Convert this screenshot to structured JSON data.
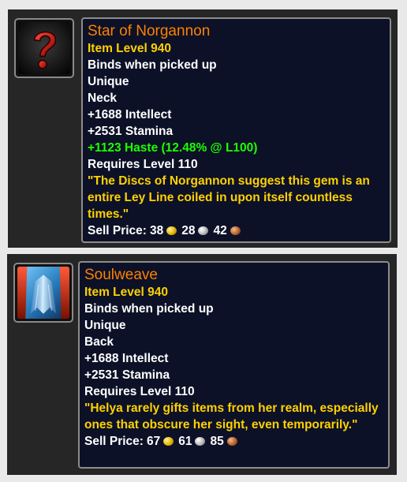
{
  "items": [
    {
      "icon": "question-mark-icon",
      "name": "Star of Norgannon",
      "item_level": "Item Level 940",
      "binding": "Binds when picked up",
      "unique": "Unique",
      "slot": "Neck",
      "stats": [
        "+1688 Intellect",
        "+2531 Stamina"
      ],
      "bonus": "+1123 Haste (12.48% @ L100)",
      "requires": "Requires Level 110",
      "flavor": "\"The Discs of Norgannon suggest this gem is an entire Ley Line coiled in upon itself countless times.\"",
      "sell_label": "Sell Price:",
      "sell": {
        "gold": "38",
        "silver": "28",
        "copper": "42"
      }
    },
    {
      "icon": "cloak-icon",
      "name": "Soulweave",
      "item_level": "Item Level 940",
      "binding": "Binds when picked up",
      "unique": "Unique",
      "slot": "Back",
      "stats": [
        "+1688 Intellect",
        "+2531 Stamina"
      ],
      "requires": "Requires Level 110",
      "flavor": "\"Helya rarely gifts items from her realm, especially ones that obscure her sight, even temporarily.\"",
      "sell_label": "Sell Price:",
      "sell": {
        "gold": "67",
        "silver": "61",
        "copper": "85"
      }
    }
  ],
  "colors": {
    "legendary_name": "#ff8000",
    "item_level": "#ffd100",
    "bonus_green": "#1eff00",
    "tooltip_bg": "#0c1127"
  }
}
